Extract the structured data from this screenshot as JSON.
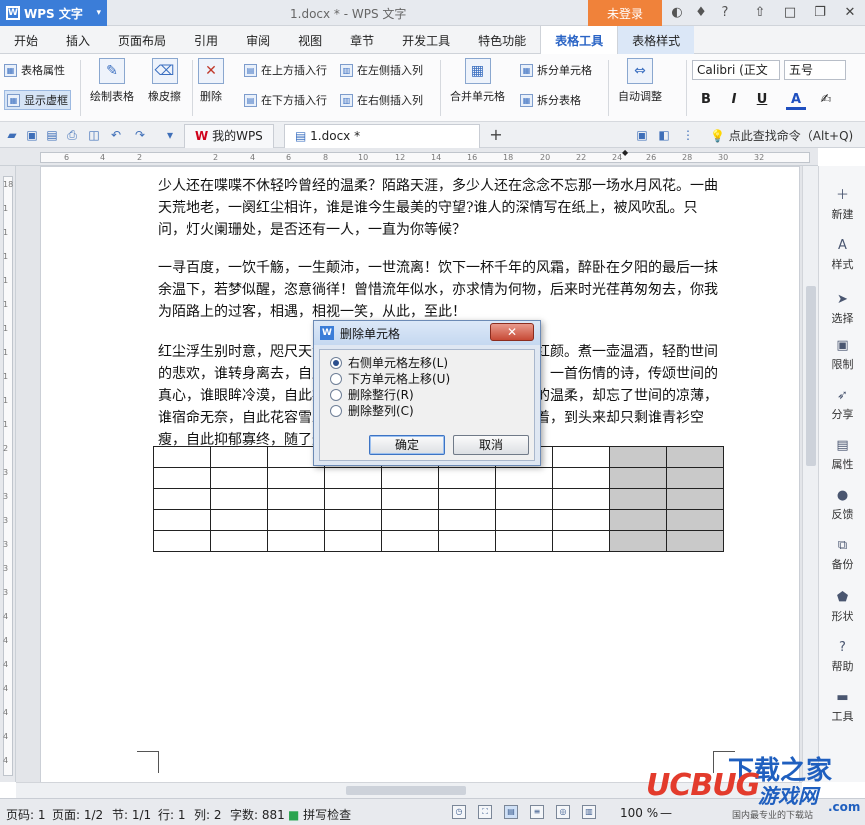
{
  "titlebar": {
    "app_name": "WPS 文字",
    "doc_title": "1.docx * - WPS 文字",
    "login_label": "未登录",
    "minimize": "—",
    "restore": "□",
    "close": "✕"
  },
  "menu": {
    "tabs": [
      "开始",
      "插入",
      "页面布局",
      "引用",
      "审阅",
      "视图",
      "章节",
      "开发工具",
      "特色功能",
      "表格工具",
      "表格样式"
    ]
  },
  "ribbon": {
    "table_props": "表格属性",
    "show_grid": "显示虚框",
    "draw_table": "绘制表格",
    "eraser": "橡皮擦",
    "delete": "删除",
    "insert_above": "在上方插入行",
    "insert_below": "在下方插入行",
    "insert_left": "在左侧插入列",
    "insert_right": "在右侧插入列",
    "merge_cells": "合并单元格",
    "split_cells": "拆分单元格",
    "split_table": "拆分表格",
    "auto_adjust": "自动调整",
    "font_name": "Calibri (正文",
    "font_size": "五号",
    "bold": "B",
    "italic": "I",
    "underline": "U",
    "font_color": "A"
  },
  "docbar": {
    "my_wps": "我的WPS",
    "doc_tab": "1.docx *",
    "add_tab": "+",
    "find_cmd": "点此查找命令（Alt+Q)"
  },
  "ruler": {
    "numbers": [
      "6",
      "4",
      "2",
      "2",
      "4",
      "6",
      "8",
      "10",
      "12",
      "14",
      "16",
      "18",
      "20",
      "22",
      "24",
      "26",
      "28",
      "30",
      "32",
      "34",
      "38"
    ],
    "vnumbers": [
      "18",
      "1",
      "1",
      "1",
      "1",
      "1",
      "1",
      "1",
      "1",
      "1",
      "1",
      "2",
      "3",
      "3",
      "3",
      "3",
      "3",
      "3",
      "4",
      "4",
      "4",
      "4",
      "4",
      "4",
      "4"
    ]
  },
  "document": {
    "para1": "少人还在喋喋不休轻吟曾经的温柔？陌路天涯，多少人还在念念不忘那一场水月风花。一曲天荒地老，一阕红尘相许，谁是谁今生最美的守望?谁人的深情写在纸上，被风吹乱。只问，灯火阑珊处，是否还有一人，一直为你等候？",
    "para2": "一寻百度，一饮千觞，一生颠沛，一世流离！饮下一杯千年的风霜，醉卧在夕阳的最后一抹余温下，若梦似醒，恣意徜徉！曾惜流年似水，亦求情为何物，后来时光荏苒匆匆去，你我为陌路上的过客，相遇，相视一笑，从此，至此！",
    "para3": "红尘浮生别时意，咫尺天涯心未远，纵有千般滋味，与谁共赏红颜。煮一壶温酒，轻酌世间的悲欢，谁转身离去，自此留下无数的惆怅与缠绵。一曲离殇，一首伤情的诗，传颂世间的真心，谁眼眸冷漠，自此痴人泪尽，此生只为追寻那一份不变的温柔，却忘了世间的凉薄，谁宿命无奈，自此花容雪发，守了这一句诺言，念了一世的执着，到头来却只剩谁青衫空瘦，自此抑郁寡终，随了这一生孤独……",
    "table_rows": 5,
    "table_cols": 10,
    "selected_cols": [
      8,
      9
    ]
  },
  "dialog": {
    "title": "删除单元格",
    "close": "✕",
    "options": [
      "右侧单元格左移(L)",
      "下方单元格上移(U)",
      "删除整行(R)",
      "删除整列(C)"
    ],
    "selected_index": 0,
    "ok": "确定",
    "cancel": "取消"
  },
  "sidebar": {
    "items": [
      "新建",
      "样式",
      "选择",
      "限制",
      "分享",
      "属性",
      "反馈",
      "备份",
      "形状",
      "帮助",
      "工具"
    ]
  },
  "statusbar": {
    "page_code": "页码: 1",
    "page": "页面: 1/2",
    "section": "节: 1/1",
    "row": "行: 1",
    "col": "列: 2",
    "word_count": "字数: 881",
    "spell_check": "拼写检查",
    "zoom": "100 %",
    "zoom_minus": "—"
  },
  "watermark": {
    "brand": "UCBUG",
    "cn1": "下载之家",
    "cn2": "游戏网",
    "domain": ".com",
    "small_text": "国内最专业的下载站"
  },
  "colors": {
    "accent": "#3b7dd8",
    "login": "#f0823a",
    "selected_cell": "#c9c9c9",
    "watermark_red": "#e33b2c",
    "watermark_blue": "#1f5fbf"
  }
}
